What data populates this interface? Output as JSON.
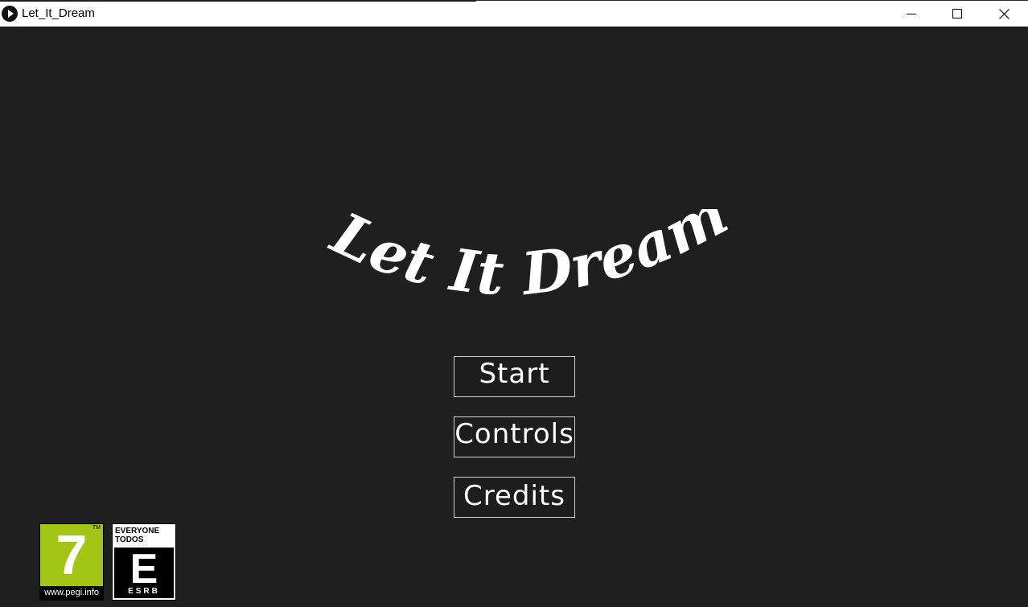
{
  "window": {
    "title": "Let_It_Dream"
  },
  "game": {
    "title": "Let It Dream",
    "title_color": "#ffffff",
    "background_color": "#1f1f1f"
  },
  "menu": {
    "start_label": "Start",
    "controls_label": "Controls",
    "credits_label": "Credits"
  },
  "ratings": {
    "pegi": {
      "age": "7",
      "trademark": "TM",
      "url": "www.pegi.info",
      "color": "#a3c515"
    },
    "esrb": {
      "line1": "EVERYONE",
      "line2": "TODOS",
      "letter": "E",
      "brand": "ESRB"
    }
  }
}
